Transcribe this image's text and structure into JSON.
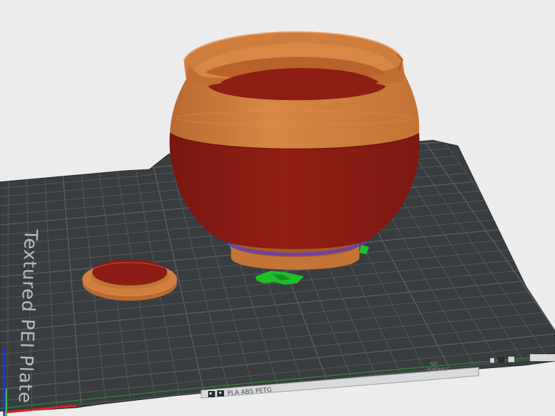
{
  "viewport": {
    "background": "#ececec",
    "plate_color": "#3a3d3f",
    "grid_color": "#5a5e61",
    "pot_orange": "#d2803e",
    "pot_red": "#8d1d15",
    "support_green": "#1fbf2a",
    "seam_purple": "#5a3cc8"
  },
  "plate": {
    "side_text": "Textured PEI Plate",
    "footer_text": "PLA ABS PETG",
    "corner_text_line1": "REF",
    "corner_text_line2": "PORTABLE",
    "logo_icon": "prusa-logo-icon",
    "smooth_icon": "smooth-sheet-icon"
  },
  "objects": {
    "main": "pot",
    "secondary": "lid"
  }
}
